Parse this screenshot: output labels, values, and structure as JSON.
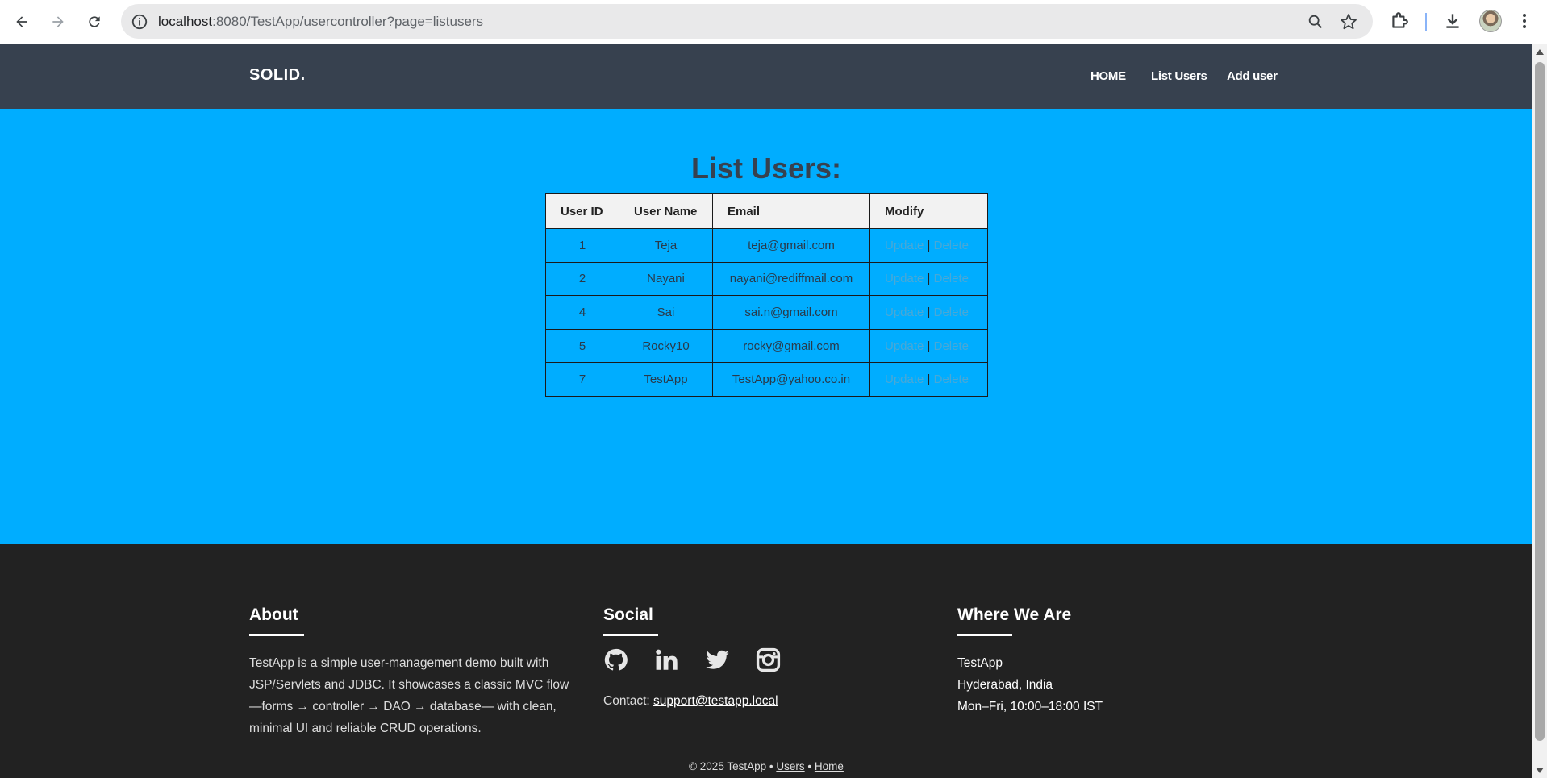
{
  "browser": {
    "url_host": "localhost",
    "url_path": ":8080/TestApp/usercontroller?page=listusers"
  },
  "header": {
    "brand": "SOLID.",
    "nav": [
      {
        "label": "HOME"
      },
      {
        "label": "List Users"
      },
      {
        "label": "Add user"
      }
    ]
  },
  "main": {
    "title": "List Users:",
    "columns": [
      "User ID",
      "User Name",
      "Email",
      "Modify"
    ],
    "rows": [
      {
        "id": "1",
        "name": "Teja",
        "email": "teja@gmail.com",
        "update": "Update",
        "sep": "|",
        "delete": "Delete"
      },
      {
        "id": "2",
        "name": "Nayani",
        "email": "nayani@rediffmail.com",
        "update": "Update",
        "sep": "|",
        "delete": "Delete"
      },
      {
        "id": "4",
        "name": "Sai",
        "email": "sai.n@gmail.com",
        "update": "Update",
        "sep": "|",
        "delete": "Delete"
      },
      {
        "id": "5",
        "name": "Rocky10",
        "email": "rocky@gmail.com",
        "update": "Update",
        "sep": "|",
        "delete": "Delete"
      },
      {
        "id": "7",
        "name": "TestApp",
        "email": "TestApp@yahoo.co.in",
        "update": "Update",
        "sep": "|",
        "delete": "Delete"
      }
    ]
  },
  "footer": {
    "about_title": "About",
    "about_text": "TestApp is a simple user-management demo built with JSP/Servlets and JDBC. It showcases a classic MVC flow—forms → controller → DAO → database— with clean, minimal UI and reliable CRUD operations.",
    "social_title": "Social",
    "social_icons": [
      "github-icon",
      "linkedin-icon",
      "twitter-icon",
      "instagram-icon"
    ],
    "contact_label": "Contact:",
    "contact_email": "support@testapp.local",
    "where_title": "Where We Are",
    "where_lines": [
      "TestApp",
      "Hyderabad, India",
      "Mon–Fri, 10:00–18:00 IST"
    ],
    "copyright": "© 2025 TestApp •",
    "link_users": "Users",
    "bullet": "•",
    "link_home": "Home"
  },
  "colors": {
    "header_bg": "#37414f",
    "hero_bg": "#00adff",
    "footer_bg": "#222222"
  }
}
